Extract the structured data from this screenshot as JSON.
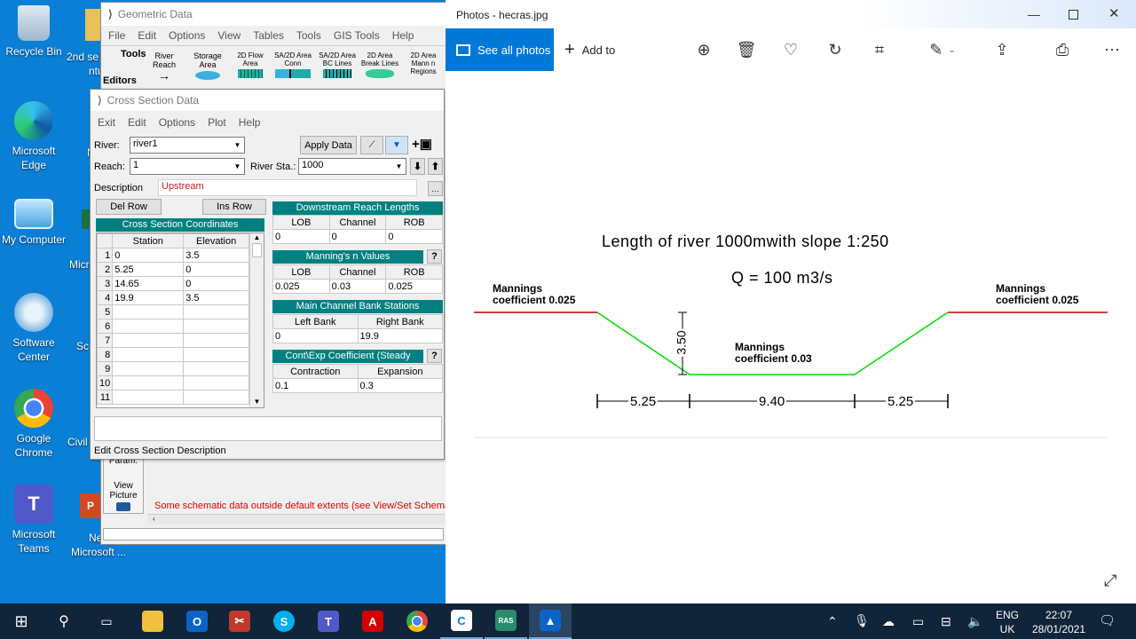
{
  "desktop": {
    "icons": [
      {
        "label": "Recycle Bin"
      },
      {
        "label": "Microsoft Edge"
      },
      {
        "label": "My Computer"
      },
      {
        "label": "Software Center"
      },
      {
        "label": "Google Chrome"
      },
      {
        "label": "Microsoft Teams"
      }
    ],
    "partial_labels": [
      "2nd se",
      "ntu",
      "Ne",
      "Micr",
      "Sc",
      "Civil",
      "M",
      "Ne",
      "Microsoft ..."
    ]
  },
  "geometric": {
    "title": "Geometric Data",
    "menu": [
      "File",
      "Edit",
      "Options",
      "View",
      "Tables",
      "Tools",
      "GIS Tools",
      "Help"
    ],
    "tools_label": "Tools",
    "editors_label": "Editors",
    "toolbar": [
      "River Reach",
      "Storage Area",
      "2D Flow Area",
      "SA/2D Area Conn",
      "SA/2D Area BC Lines",
      "2D Area Break Lines",
      "2D Area Mann n Regions"
    ],
    "side_buttons": [
      "Param.",
      "View Picture"
    ],
    "status_message": "Some schematic data outside default extents (see View/Set Schema"
  },
  "xs": {
    "title": "Cross Section Data",
    "menu": [
      "Exit",
      "Edit",
      "Options",
      "Plot",
      "Help"
    ],
    "river_label": "River:",
    "river_value": "river1",
    "reach_label": "Reach:",
    "reach_value": "1",
    "river_sta_label": "River Sta.:",
    "river_sta_value": "1000",
    "apply_label": "Apply Data",
    "description_label": "Description",
    "description_value": "Upstream",
    "del_row": "Del Row",
    "ins_row": "Ins Row",
    "coords_title": "Cross Section Coordinates",
    "coords_cols": [
      "Station",
      "Elevation"
    ],
    "coords_rows": [
      [
        "1",
        "0",
        "3.5"
      ],
      [
        "2",
        "5.25",
        "0"
      ],
      [
        "3",
        "14.65",
        "0"
      ],
      [
        "4",
        "19.9",
        "3.5"
      ],
      [
        "5",
        "",
        ""
      ],
      [
        "6",
        "",
        ""
      ],
      [
        "7",
        "",
        ""
      ],
      [
        "8",
        "",
        ""
      ],
      [
        "9",
        "",
        ""
      ],
      [
        "10",
        "",
        ""
      ],
      [
        "11",
        "",
        ""
      ]
    ],
    "downstream_title": "Downstream Reach Lengths",
    "lob": "LOB",
    "channel": "Channel",
    "rob": "ROB",
    "downstream_values": [
      "0",
      "0",
      "0"
    ],
    "mannings_title": "Manning's n Values",
    "help_glyph": "?",
    "mannings_values": [
      "0.025",
      "0.03",
      "0.025"
    ],
    "bank_title": "Main Channel Bank Stations",
    "left_bank": "Left Bank",
    "right_bank": "Right Bank",
    "bank_values": [
      "0",
      "19.9"
    ],
    "cont_title": "Cont\\Exp Coefficient (Steady",
    "contraction": "Contraction",
    "expansion": "Expansion",
    "cont_values": [
      "0.1",
      "0.3"
    ],
    "status": "Edit Cross Section Description"
  },
  "photos": {
    "title": "Photos - hecras.jpg",
    "see_all": "See all photos",
    "add_to": "Add to",
    "image": {
      "heading1": "Length of river 1000mwith slope 1:250",
      "heading2": "Q = 100 m3/s",
      "left_label1": "Mannings",
      "left_label2": "coefficient 0.025",
      "right_label1": "Mannings",
      "right_label2": "coefficient 0.025",
      "mid_label1": "Mannings",
      "mid_label2": "coefficient 0.03",
      "depth": "3.50",
      "dim_left": "5.25",
      "dim_mid": "9.40",
      "dim_right": "5.25"
    }
  },
  "tray": {
    "lang1": "ENG",
    "lang2": "UK",
    "time": "22:07",
    "date": "28/01/2021"
  },
  "colors": {
    "desktop": "#0a7fd6",
    "teal": "#008080",
    "photos_accent": "#0078d7",
    "bank": "#c00000",
    "channel": "#00dd00"
  }
}
